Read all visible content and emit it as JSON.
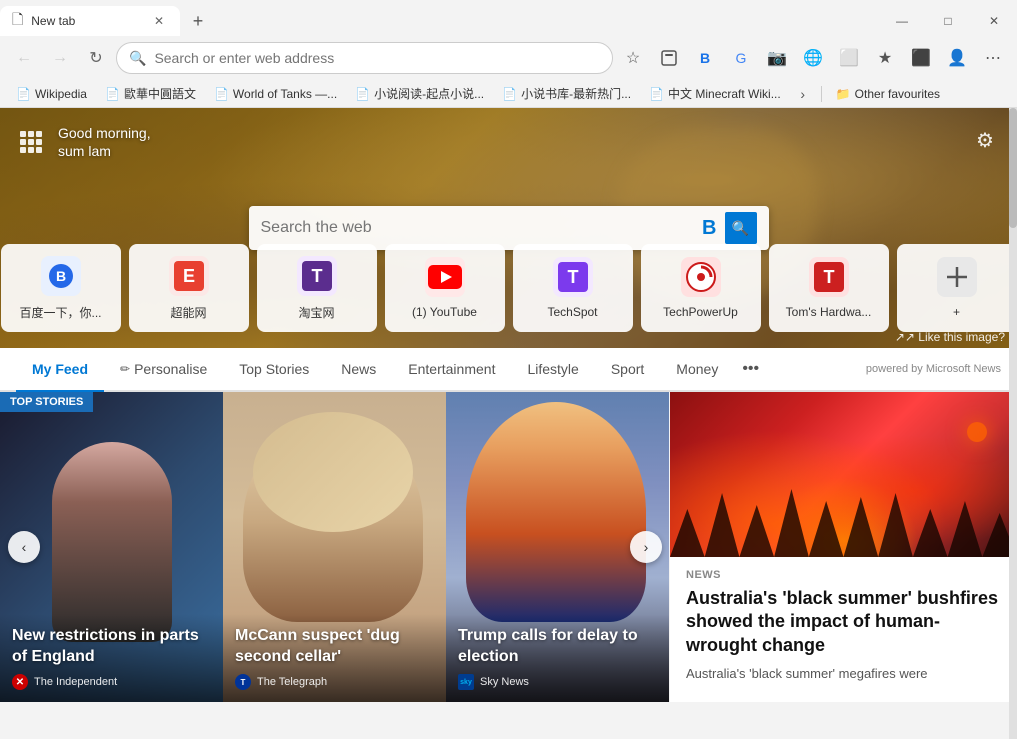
{
  "browser": {
    "tab": {
      "title": "New tab",
      "favicon": "📄"
    },
    "new_tab_btn": "+",
    "window_controls": {
      "minimize": "—",
      "maximize": "□",
      "close": "✕"
    }
  },
  "navbar": {
    "back": "←",
    "forward": "→",
    "refresh": "↻",
    "address_placeholder": "Search or enter web address",
    "address_value": "",
    "star": "☆",
    "actions": [
      "⬛",
      "🔵",
      "🌐",
      "📷",
      "🌍",
      "⬜",
      "★",
      "⬛",
      "👤",
      "⋯"
    ]
  },
  "bookmarks": [
    {
      "label": "Wikipedia",
      "icon": "📄"
    },
    {
      "label": "歐華中圓語文",
      "icon": "📄"
    },
    {
      "label": "World of Tanks —...",
      "icon": "📄"
    },
    {
      "label": "小说阅读-起点小说...",
      "icon": "📄"
    },
    {
      "label": "小说书库-最新热门...",
      "icon": "📄"
    },
    {
      "label": "中文 Minecraft Wiki...",
      "icon": "📄"
    }
  ],
  "bookmarks_more": "›",
  "bookmarks_other_label": "Other favourites",
  "hero": {
    "grid_label": "Grid menu",
    "greeting_line1": "Good morning,",
    "greeting_line2": "sum lam",
    "search_placeholder": "Search the web",
    "search_bing_label": "B",
    "search_btn_label": "🔍",
    "gear_label": "⚙",
    "like_image_label": "↗ Like this image?"
  },
  "quick_links": [
    {
      "label": "百度一下，你...",
      "icon_bg": "#2468e8",
      "icon_char": "🐾",
      "icon_color": "#2468e8"
    },
    {
      "label": "超能网",
      "icon_bg": "#e84030",
      "icon_char": "E",
      "icon_color": "#e84030"
    },
    {
      "label": "淘宝网",
      "icon_bg": "#5b2d8e",
      "icon_char": "T",
      "icon_color": "#5b2d8e"
    },
    {
      "label": "(1) YouTube",
      "icon_bg": "#ff0000",
      "icon_char": "▶",
      "icon_color": "#ff0000"
    },
    {
      "label": "TechSpot",
      "icon_bg": "#7c3aed",
      "icon_char": "T",
      "icon_color": "#7c3aed"
    },
    {
      "label": "TechPowerUp",
      "icon_bg": "#cc1a1a",
      "icon_char": "⏻",
      "icon_color": "#cc1a1a"
    },
    {
      "label": "Tom's Hardwa...",
      "icon_bg": "#cc2020",
      "icon_char": "T",
      "icon_color": "#cc2020"
    },
    {
      "label": "+",
      "icon_bg": "#e0e0e0",
      "icon_char": "+",
      "icon_color": "#555"
    }
  ],
  "feed": {
    "tabs": [
      {
        "label": "My Feed",
        "active": true
      },
      {
        "label": "Personalise",
        "personalise": true
      },
      {
        "label": "Top Stories"
      },
      {
        "label": "News"
      },
      {
        "label": "Entertainment"
      },
      {
        "label": "Lifestyle"
      },
      {
        "label": "Sport"
      },
      {
        "label": "Money"
      }
    ],
    "more_label": "•••",
    "powered_by": "powered by Microsoft News"
  },
  "articles": {
    "top_stories_badge": "TOP STORIES",
    "carousel_prev": "‹",
    "carousel_next": "›",
    "items": [
      {
        "title": "New restrictions in parts of England",
        "source": "The Independent",
        "source_color": "#cc0000",
        "has_badge": true
      },
      {
        "title": "McCann suspect 'dug second cellar'",
        "source": "The Telegraph",
        "source_color": "#0066cc"
      },
      {
        "title": "Trump calls for delay to election",
        "source": "Sky News",
        "source_color": "#cc0000"
      }
    ],
    "right_article": {
      "label": "NEWS",
      "title": "Australia's 'black summer' bushfires showed the impact of human-wrought change",
      "description": "Australia's 'black summer' megafires were"
    }
  }
}
